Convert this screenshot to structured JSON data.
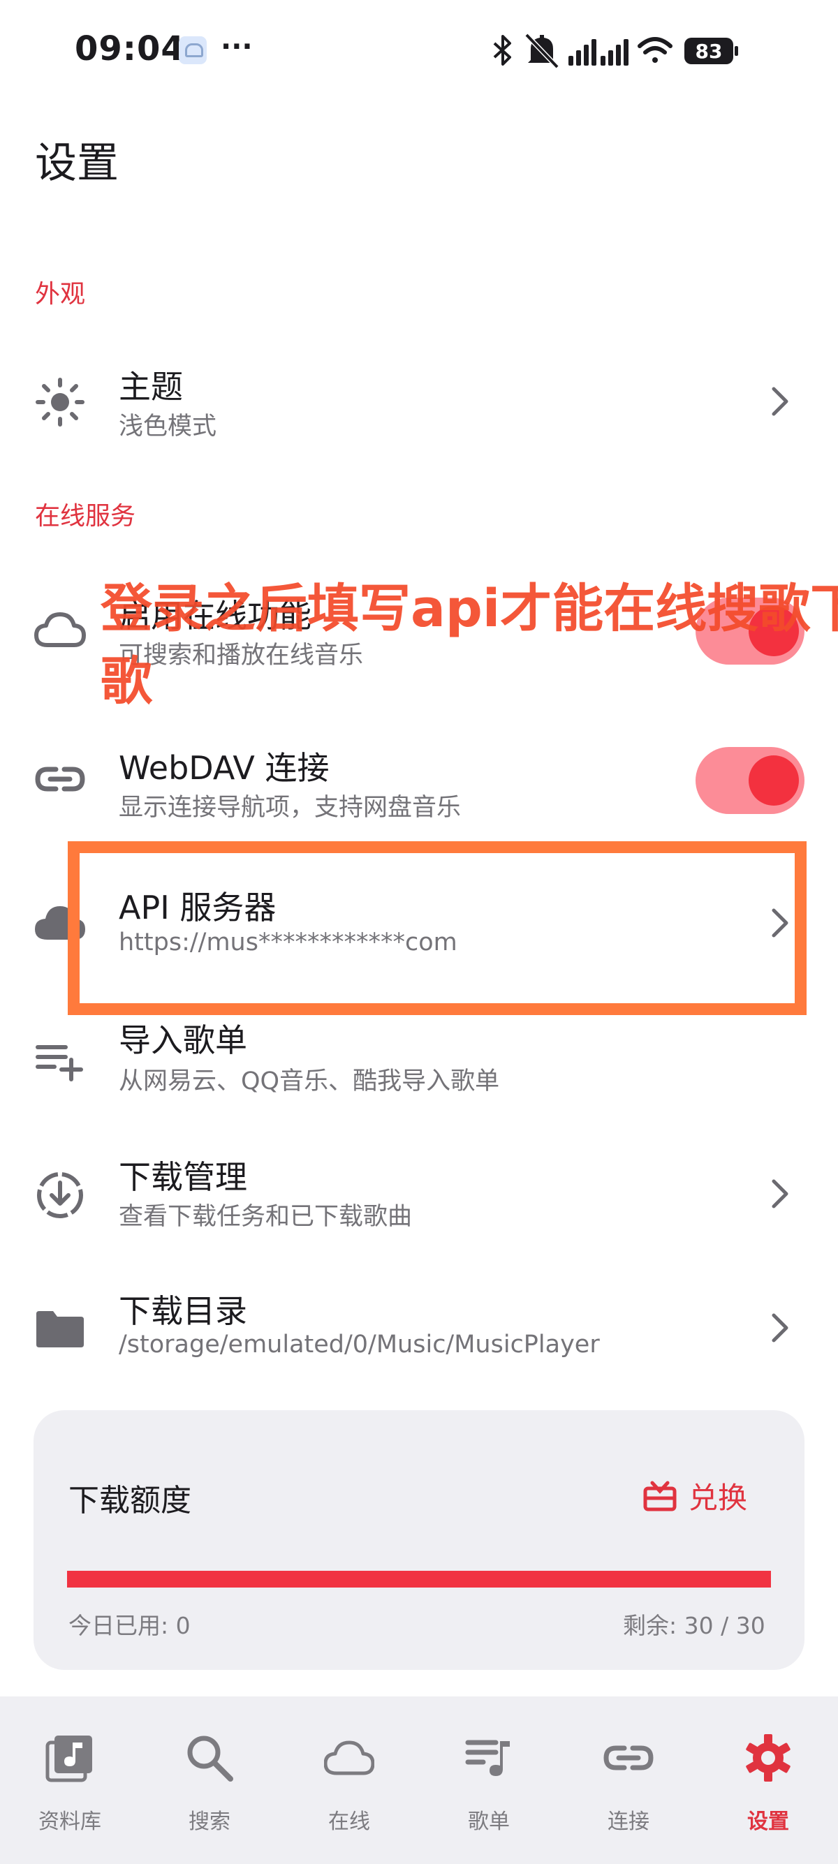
{
  "status_bar": {
    "time": "09:04",
    "more": "···",
    "battery": "83",
    "icons": [
      "bluetooth-icon",
      "mute-icon",
      "signal-icon",
      "signal-icon",
      "wifi-icon",
      "battery-icon"
    ]
  },
  "page": {
    "title": "设置"
  },
  "sections": {
    "appearance": "外观",
    "online": "在线服务"
  },
  "rows": {
    "theme": {
      "title": "主题",
      "subtitle": "浅色模式",
      "icon": "sun-icon"
    },
    "online_features": {
      "title": "启用在线功能",
      "subtitle": "可搜索和播放在线音乐",
      "icon": "cloud-icon",
      "enabled": true
    },
    "webdav": {
      "title": "WebDAV 连接",
      "subtitle": "显示连接导航项，支持网盘音乐",
      "icon": "link-icon",
      "enabled": true
    },
    "api_server": {
      "title": "API 服务器",
      "subtitle": "https://mus************com",
      "icon": "cloud-filled-icon"
    },
    "import_playlist": {
      "title": "导入歌单",
      "subtitle": "从网易云、QQ音乐、酷我导入歌单",
      "icon": "playlist-add-icon"
    },
    "download_manager": {
      "title": "下载管理",
      "subtitle": "查看下载任务和已下载歌曲",
      "icon": "download-circle-icon"
    },
    "download_dir": {
      "title": "下载目录",
      "subtitle": "/storage/emulated/0/Music/MusicPlayer",
      "icon": "folder-icon"
    }
  },
  "annotation": {
    "text": "登录之后填写api才能在线搜歌下歌",
    "color": "#f44b2b",
    "box_color": "#ff7a3c"
  },
  "quota": {
    "title": "下载额度",
    "redeem_label": "兑换",
    "used_label": "今日已用: 0",
    "remaining_label": "剩余: 30 / 30",
    "used": 0,
    "total": 30,
    "bar_color": "#f13342"
  },
  "nav": {
    "items": [
      {
        "label": "资料库",
        "icon": "library-music-icon",
        "active": false
      },
      {
        "label": "搜索",
        "icon": "search-icon",
        "active": false
      },
      {
        "label": "在线",
        "icon": "cloud-icon",
        "active": false
      },
      {
        "label": "歌单",
        "icon": "queue-music-icon",
        "active": false
      },
      {
        "label": "连接",
        "icon": "link-icon",
        "active": false
      },
      {
        "label": "设置",
        "icon": "settings-gear-icon",
        "active": true
      }
    ]
  },
  "colors": {
    "accent": "#e0333f",
    "switch_track": "#fc8c97",
    "switch_knob": "#f3313f",
    "card_bg": "#efeff3"
  }
}
